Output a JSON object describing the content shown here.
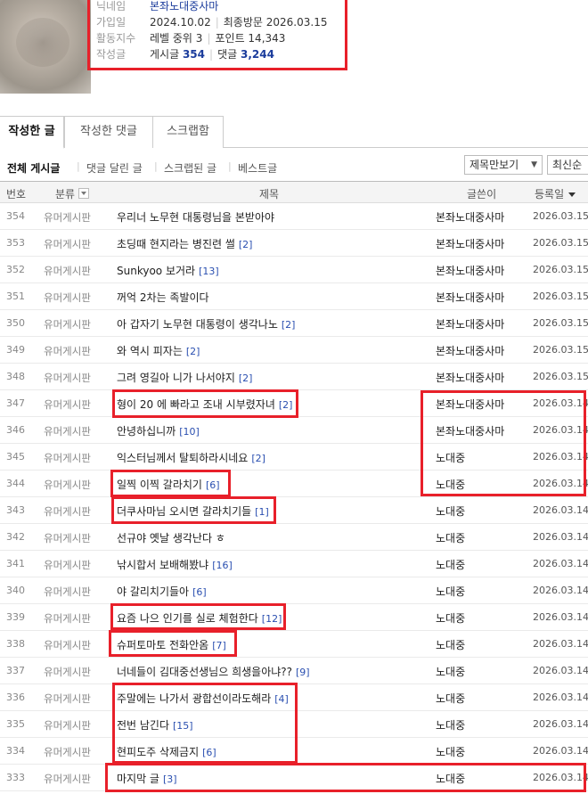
{
  "profile": {
    "avatar": "avatar-blurred",
    "labels": {
      "nickname": "닉네임",
      "joined": "가입일",
      "activity": "활동지수",
      "posts": "작성글"
    },
    "nickname": "본좌노대중사마",
    "joined_date": "2024.10.02",
    "last_visit_label": "최종방문",
    "last_visit_date": "2026.03.15",
    "level": "레벨 중위 3",
    "points": "포인트 14,343",
    "posts_label": "게시글",
    "posts_count": "354",
    "comments_label": "댓글",
    "comments_count": "3,244"
  },
  "tabs": [
    "작성한 글",
    "작성한 댓글",
    "스크랩함"
  ],
  "filters": [
    "전체 게시글",
    "댓글 달린 글",
    "스크랩된 글",
    "베스트글"
  ],
  "view_select": "제목만보기",
  "sort_select": "최신순",
  "table": {
    "headers": {
      "num": "번호",
      "category": "분류",
      "title": "제목",
      "author": "글쓴이",
      "date": "등록일"
    },
    "rows": [
      {
        "num": "354",
        "cat": "유머게시판",
        "title": "우리너 노무현 대통령님을 본받아야",
        "comments": "",
        "author": "본좌노대중사마",
        "date": "2026.03.15"
      },
      {
        "num": "353",
        "cat": "유머게시판",
        "title": "초딩때 현지라는 병진련 썰",
        "comments": "[2]",
        "author": "본좌노대중사마",
        "date": "2026.03.15"
      },
      {
        "num": "352",
        "cat": "유머게시판",
        "title": "Sunkyoo 보거라",
        "comments": "[13]",
        "author": "본좌노대중사마",
        "date": "2026.03.15"
      },
      {
        "num": "351",
        "cat": "유머게시판",
        "title": "꺼억 2차는 족발이다",
        "comments": "",
        "author": "본좌노대중사마",
        "date": "2026.03.15"
      },
      {
        "num": "350",
        "cat": "유머게시판",
        "title": "아 갑자기 노무현 대통령이 생각나노",
        "comments": "[2]",
        "author": "본좌노대중사마",
        "date": "2026.03.15"
      },
      {
        "num": "349",
        "cat": "유머게시판",
        "title": "와 역시 피자는",
        "comments": "[2]",
        "author": "본좌노대중사마",
        "date": "2026.03.15"
      },
      {
        "num": "348",
        "cat": "유머게시판",
        "title": "그려 영길아 니가 나서야지",
        "comments": "[2]",
        "author": "본좌노대중사마",
        "date": "2026.03.15"
      },
      {
        "num": "347",
        "cat": "유머게시판",
        "title": "형이 20 에 빠라고 조내 시부렸자녀",
        "comments": "[2]",
        "author": "본좌노대중사마",
        "date": "2026.03.14"
      },
      {
        "num": "346",
        "cat": "유머게시판",
        "title": "안녕하십니까",
        "comments": "[10]",
        "author": "본좌노대중사마",
        "date": "2026.03.14"
      },
      {
        "num": "345",
        "cat": "유머게시판",
        "title": "익스터님께서 탈퇴하라시네요",
        "comments": "[2]",
        "author": "노대중",
        "date": "2026.03.14"
      },
      {
        "num": "344",
        "cat": "유머게시판",
        "title": "일찍 이찍 갈라치기",
        "comments": "[6]",
        "author": "노대중",
        "date": "2026.03.14"
      },
      {
        "num": "343",
        "cat": "유머게시판",
        "title": "더쿠사마님 오시면 갈라치기들",
        "comments": "[1]",
        "author": "노대중",
        "date": "2026.03.14"
      },
      {
        "num": "342",
        "cat": "유머게시판",
        "title": "선규야 옛날 생각난다 ㅎ",
        "comments": "",
        "author": "노대중",
        "date": "2026.03.14"
      },
      {
        "num": "341",
        "cat": "유머게시판",
        "title": "낚시합서 보배해봤냐",
        "comments": "[16]",
        "author": "노대중",
        "date": "2026.03.14"
      },
      {
        "num": "340",
        "cat": "유머게시판",
        "title": "야 갈리치기들아",
        "comments": "[6]",
        "author": "노대중",
        "date": "2026.03.14"
      },
      {
        "num": "339",
        "cat": "유머게시판",
        "title": "요즘 나으 인기를 실로 체험한다",
        "comments": "[12]",
        "author": "노대중",
        "date": "2026.03.14"
      },
      {
        "num": "338",
        "cat": "유머게시판",
        "title": "슈퍼토마토 전화안옴",
        "comments": "[7]",
        "author": "노대중",
        "date": "2026.03.14"
      },
      {
        "num": "337",
        "cat": "유머게시판",
        "title": "너네들이 김대중선생님으 희생을아냐??",
        "comments": "[9]",
        "author": "노대중",
        "date": "2026.03.14"
      },
      {
        "num": "336",
        "cat": "유머게시판",
        "title": "주말에는 나가서 광합선이라도해라",
        "comments": "[4]",
        "author": "노대중",
        "date": "2026.03.14"
      },
      {
        "num": "335",
        "cat": "유머게시판",
        "title": "전번 남긴다",
        "comments": "[15]",
        "author": "노대중",
        "date": "2026.03.14"
      },
      {
        "num": "334",
        "cat": "유머게시판",
        "title": "현피도주 삭제금지",
        "comments": "[6]",
        "author": "노대중",
        "date": "2026.03.14"
      },
      {
        "num": "333",
        "cat": "유머게시판",
        "title": "마지막 글",
        "comments": "[3]",
        "author": "노대중",
        "date": "2026.03.14"
      }
    ]
  },
  "colors": {
    "highlight": "#e8202a",
    "link": "#1b3c9c",
    "comment_count": "#2a4fb0"
  }
}
